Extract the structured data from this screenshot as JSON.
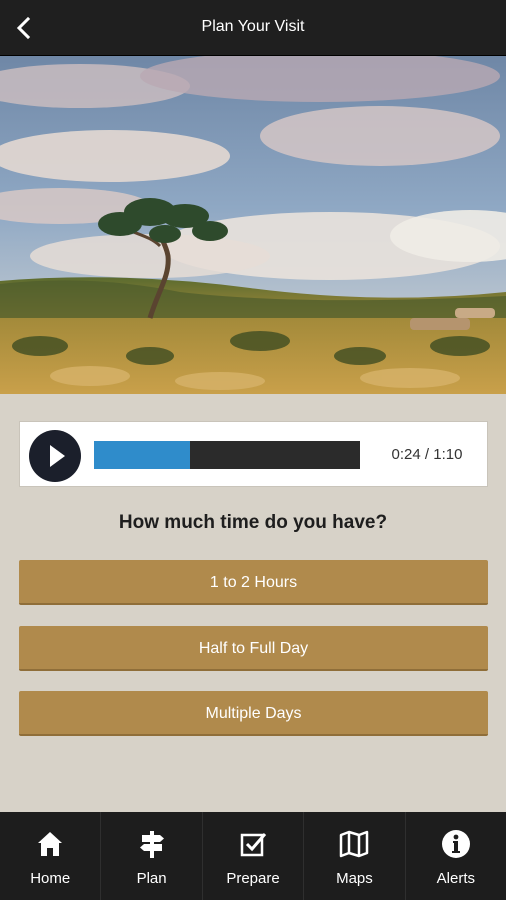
{
  "header": {
    "title": "Plan Your Visit"
  },
  "player": {
    "elapsed": "0:24 / 1:10",
    "progress_fraction": 0.36
  },
  "main": {
    "question": "How much time do you have?",
    "options": [
      {
        "label": "1 to 2 Hours"
      },
      {
        "label": "Half to Full Day"
      },
      {
        "label": "Multiple Days"
      }
    ]
  },
  "tabs": [
    {
      "label": "Home",
      "icon": "home-icon"
    },
    {
      "label": "Plan",
      "icon": "signpost-icon"
    },
    {
      "label": "Prepare",
      "icon": "checkbox-icon"
    },
    {
      "label": "Maps",
      "icon": "map-icon"
    },
    {
      "label": "Alerts",
      "icon": "info-icon"
    }
  ],
  "colors": {
    "accent_button": "#b08a4c",
    "progress": "#2f8ccb",
    "topbar": "#1f1f1f",
    "background": "#d7d2c8"
  }
}
